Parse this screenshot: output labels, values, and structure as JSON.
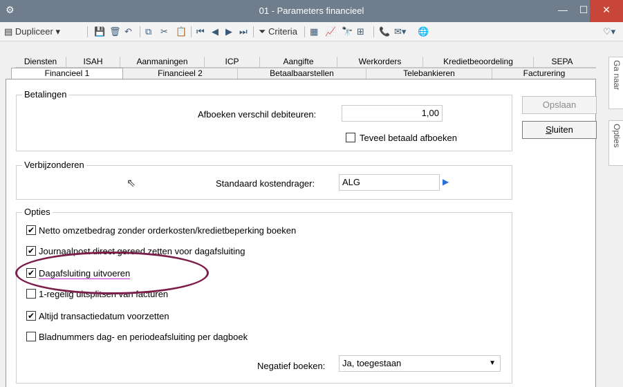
{
  "window": {
    "title": "01 - Parameters financieel",
    "app_icon": "gear-icon",
    "minimize_icon": "minimize-icon",
    "maximize_icon": "maximize-icon",
    "close_icon": "close-icon"
  },
  "toolbar": {
    "duplicate_label": "Dupliceer",
    "criteria_label": "Criteria"
  },
  "tabs": {
    "row1": [
      "Diensten",
      "ISAH",
      "Aanmaningen",
      "ICP",
      "Aangifte",
      "Werkorders",
      "Kredietbeoordeling",
      "SEPA"
    ],
    "row2": [
      "Financieel 1",
      "Financieel 2",
      "Betaalbaarstellen",
      "Telebankieren",
      "Facturering"
    ],
    "active": "Financieel 1"
  },
  "side_tabs": [
    "Ga naar",
    "Opties"
  ],
  "buttons": {
    "save": "Opslaan",
    "close": "Sluiten"
  },
  "betalingen": {
    "title": "Betalingen",
    "afboeken_label": "Afboeken verschil debiteuren:",
    "afboeken_value": "1,00",
    "teveel_label": "Teveel betaald afboeken",
    "teveel_checked": false
  },
  "verbijzonderen": {
    "title": "Verbijzonderen",
    "kostendrager_label": "Standaard kostendrager:",
    "kostendrager_value": "ALG"
  },
  "opties": {
    "title": "Opties",
    "items": [
      {
        "label": "Netto omzetbedrag zonder orderkosten/kredietbeperking boeken",
        "checked": true
      },
      {
        "label": "Journaalpost direct gereed zetten voor dagafsluiting",
        "checked": true
      },
      {
        "label": "Dagafsluiting uitvoeren",
        "checked": true
      },
      {
        "label": "1-regelig uitsplitsen van facturen",
        "checked": false
      },
      {
        "label": "Altijd transactiedatum voorzetten",
        "checked": true
      },
      {
        "label": "Bladnummers dag- en periodeafsluiting per dagboek",
        "checked": false
      }
    ],
    "negatief_label": "Negatief boeken:",
    "negatief_value": "Ja, toegestaan"
  },
  "colors": {
    "titlebar": "#6f7d8c",
    "close_button": "#c8453a",
    "highlight_ellipse": "#7b1e4b",
    "arrow_blue": "#2a6fd6"
  }
}
